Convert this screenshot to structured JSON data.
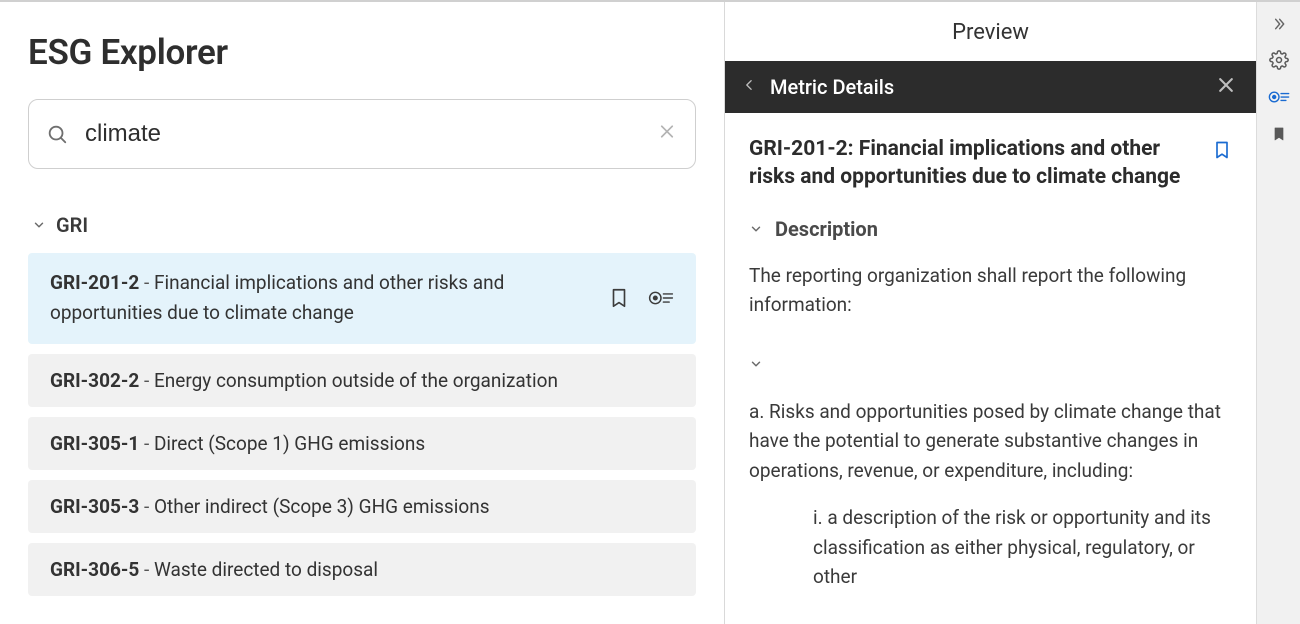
{
  "page": {
    "title": "ESG Explorer"
  },
  "search": {
    "value": "climate",
    "placeholder": ""
  },
  "group": {
    "label": "GRI"
  },
  "results": [
    {
      "code": "GRI-201-2",
      "title": "Financial implications and other risks and opportunities due to climate change",
      "selected": true
    },
    {
      "code": "GRI-302-2",
      "title": "Energy consumption outside of the organization",
      "selected": false
    },
    {
      "code": "GRI-305-1",
      "title": "Direct (Scope 1) GHG emissions",
      "selected": false
    },
    {
      "code": "GRI-305-3",
      "title": "Other indirect (Scope 3) GHG emissions",
      "selected": false
    },
    {
      "code": "GRI-306-5",
      "title": "Waste directed to disposal",
      "selected": false
    }
  ],
  "preview": {
    "pane_title": "Preview",
    "header_title": "Metric Details",
    "metric_title": "GRI-201-2: Financial implications and other risks and opportunities due to climate change",
    "section_description_label": "Description",
    "description_intro": "The reporting organization shall report the following information:",
    "description_a": "a. Risks and opportunities posed by climate change that have the potential to generate substantive changes in operations, revenue, or expenditure, including:",
    "description_a_i": "i. a description of the risk or opportunity and its classification as either physical, regulatory, or other"
  }
}
